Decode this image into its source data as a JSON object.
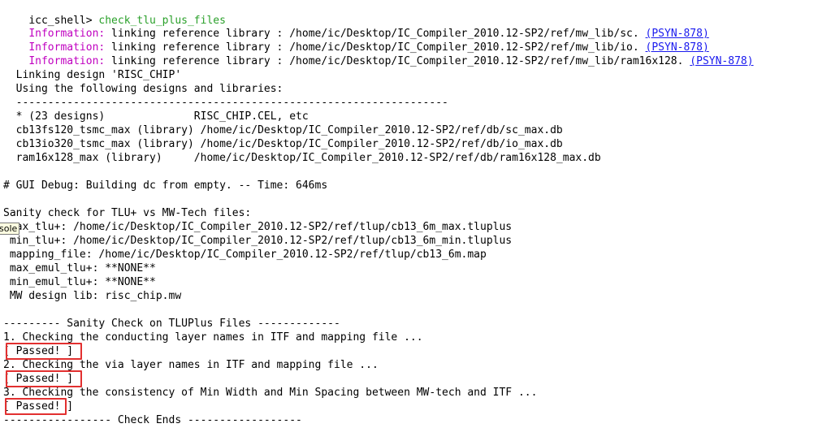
{
  "shell": {
    "prompt": "icc_shell> ",
    "command": "check_tlu_plus_files"
  },
  "info_lines": [
    {
      "label": "Information:",
      "text": " linking reference library : /home/ic/Desktop/IC_Compiler_2010.12-SP2/ref/mw_lib/sc. ",
      "code": "(PSYN-878)"
    },
    {
      "label": "Information:",
      "text": " linking reference library : /home/ic/Desktop/IC_Compiler_2010.12-SP2/ref/mw_lib/io. ",
      "code": "(PSYN-878)"
    },
    {
      "label": "Information:",
      "text": " linking reference library : /home/ic/Desktop/IC_Compiler_2010.12-SP2/ref/mw_lib/ram16x128. ",
      "code": "(PSYN-878)"
    }
  ],
  "linking": {
    "title": "  Linking design 'RISC_CHIP'",
    "using": "  Using the following designs and libraries:",
    "separator": "  --------------------------------------------------------------------",
    "rows": [
      "  * (23 designs)              RISC_CHIP.CEL, etc",
      "  cb13fs120_tsmc_max (library) /home/ic/Desktop/IC_Compiler_2010.12-SP2/ref/db/sc_max.db",
      "  cb13io320_tsmc_max (library) /home/ic/Desktop/IC_Compiler_2010.12-SP2/ref/db/io_max.db",
      "  ram16x128_max (library)     /home/ic/Desktop/IC_Compiler_2010.12-SP2/ref/db/ram16x128_max.db"
    ]
  },
  "gui_debug": "# GUI Debug: Building dc from empty. -- Time: 646ms",
  "sanity": {
    "header": "Sanity check for TLU+ vs MW-Tech files:",
    "rows": [
      " max_tlu+: /home/ic/Desktop/IC_Compiler_2010.12-SP2/ref/tlup/cb13_6m_max.tluplus",
      " min_tlu+: /home/ic/Desktop/IC_Compiler_2010.12-SP2/ref/tlup/cb13_6m_min.tluplus",
      " mapping_file: /home/ic/Desktop/IC_Compiler_2010.12-SP2/ref/tlup/cb13_6m.map",
      " max_emul_tlu+: **NONE**",
      " min_emul_tlu+: **NONE**",
      " MW design lib: risc_chip.mw"
    ]
  },
  "tooltip": "sole",
  "check": {
    "header": "--------- Sanity Check on TLUPlus Files -------------",
    "step1": "1. Checking the conducting layer names in ITF and mapping file ...",
    "result1": "[ Passed! ]",
    "step2": "2. Checking the via layer names in ITF and mapping file ...",
    "result2": "[ Passed! ]",
    "step3": "3. Checking the consistency of Min Width and Min Spacing between MW-tech and ITF ...",
    "result3": "[ Passed! ]",
    "footer": "----------------- Check Ends ------------------"
  },
  "colors": {
    "command": "#2aa02a",
    "information": "#c000c0",
    "link": "#1a1aee",
    "highlight_box": "#e23030"
  }
}
